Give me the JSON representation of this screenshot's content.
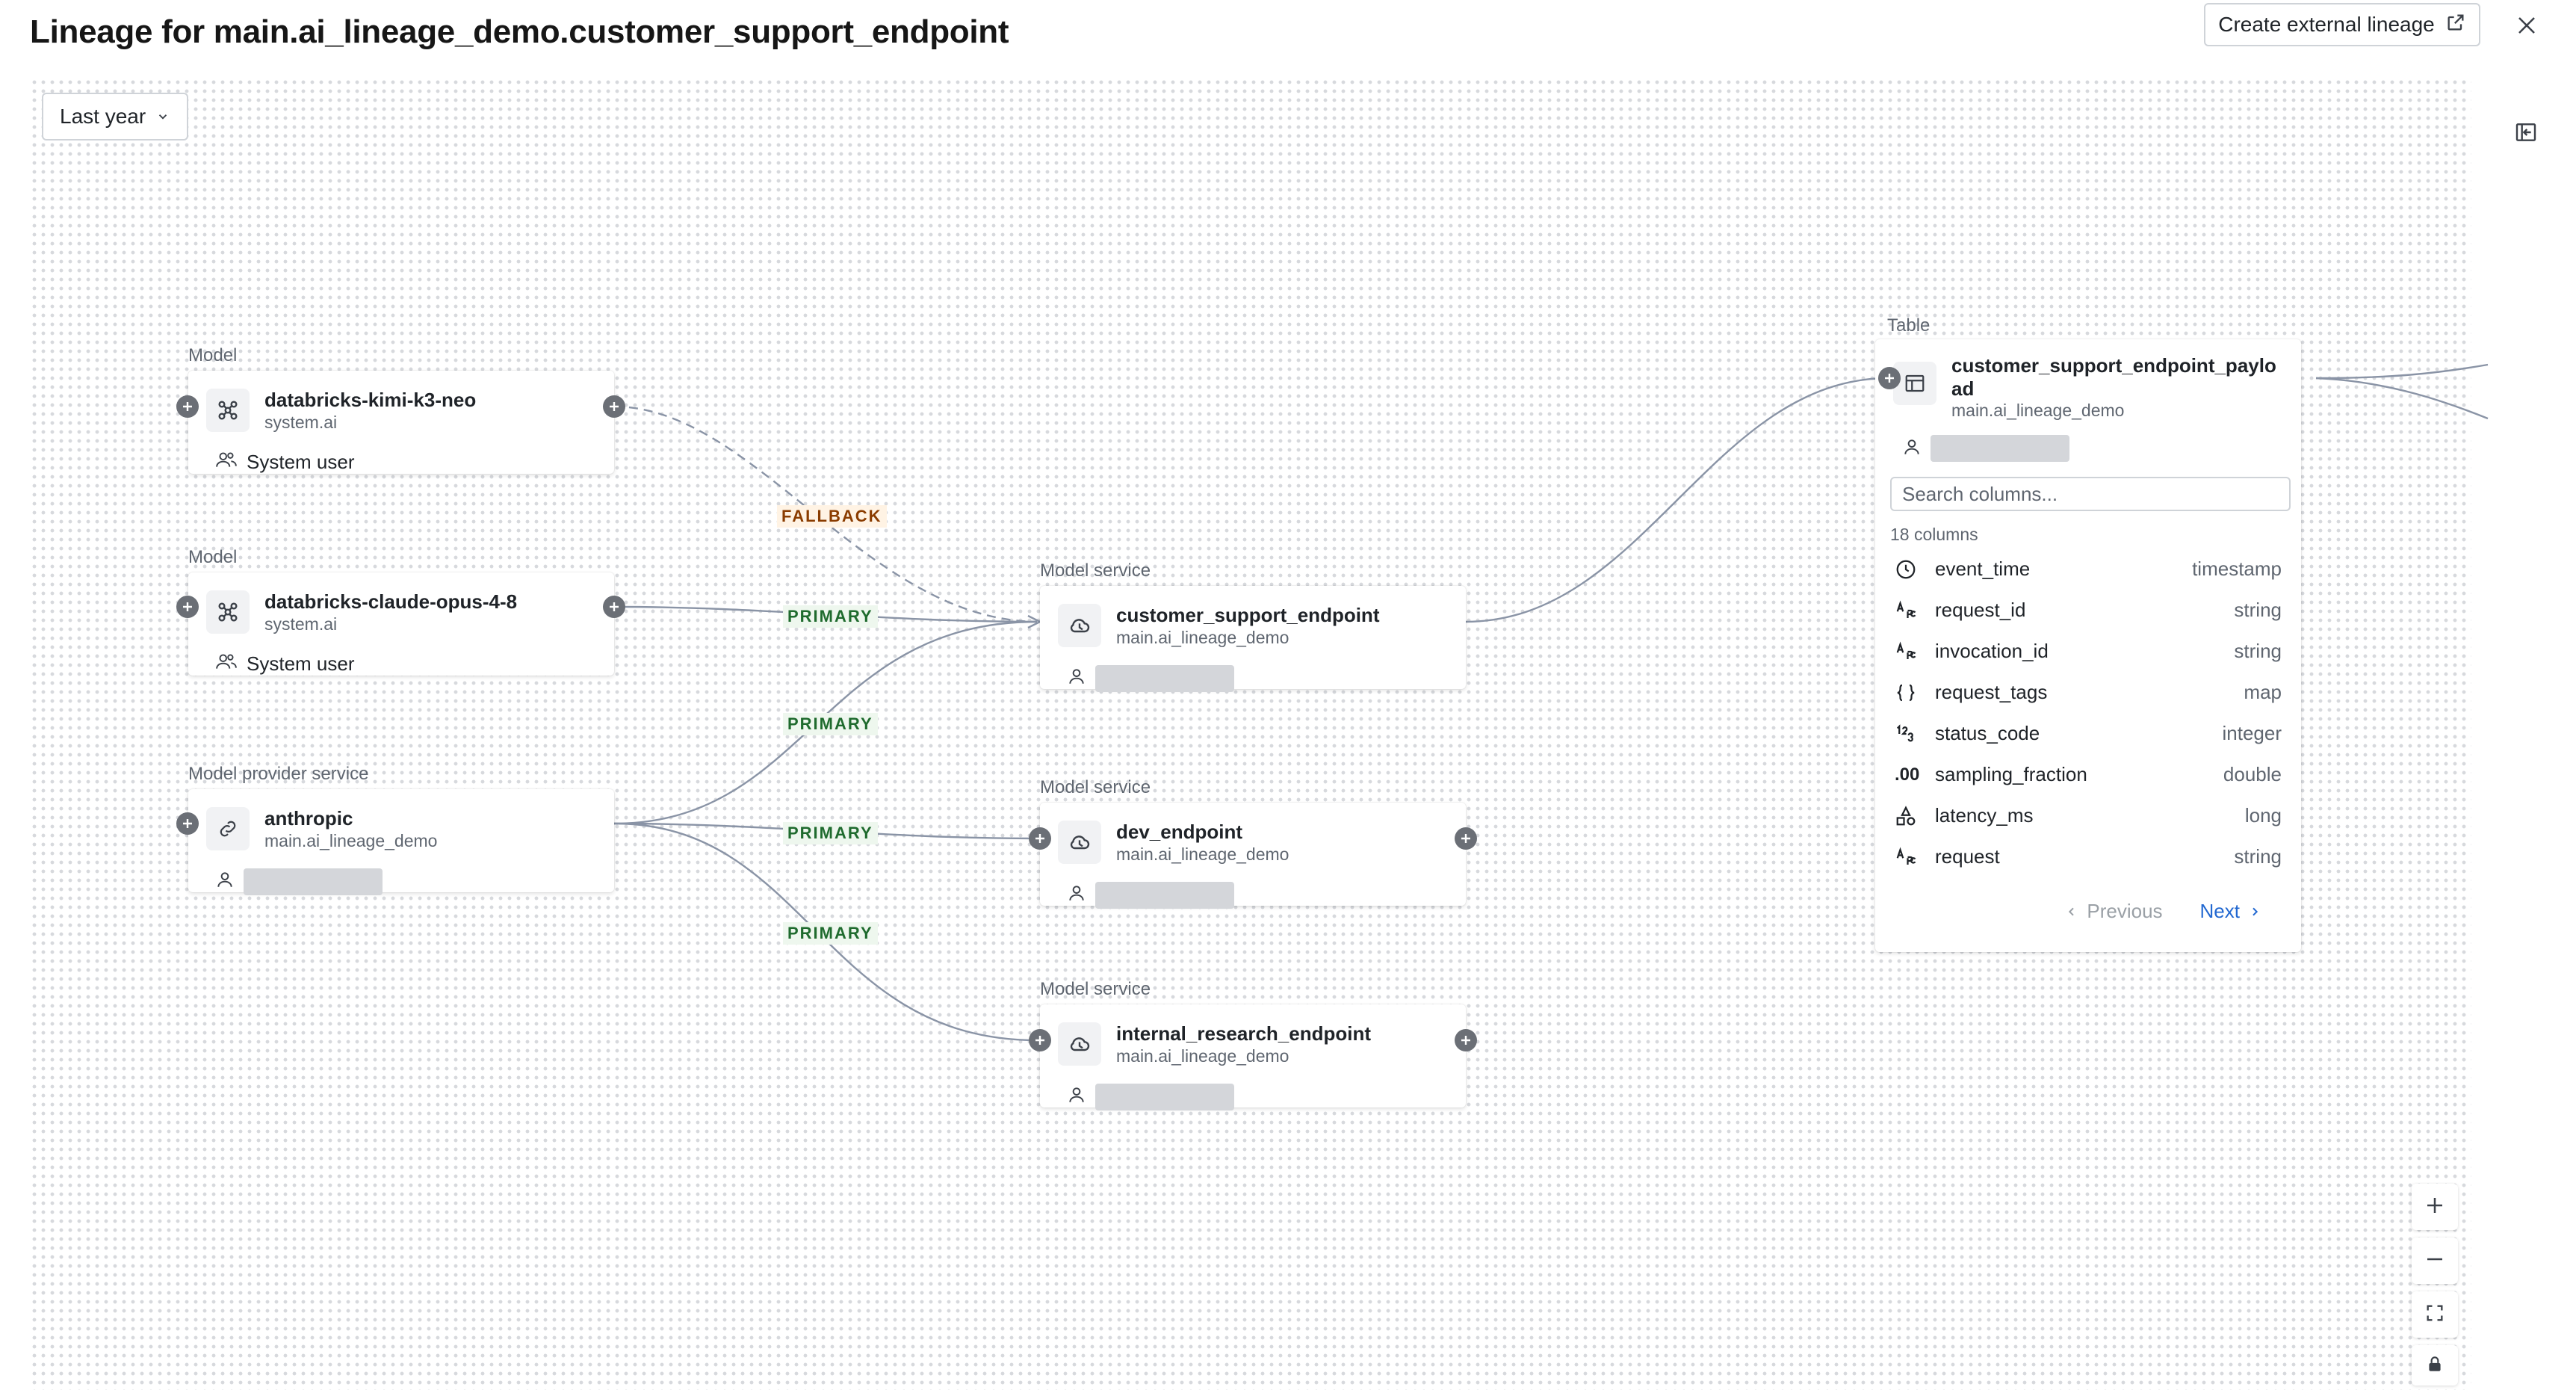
{
  "header": {
    "title": "Lineage for main.ai_lineage_demo.customer_support_endpoint",
    "create_external_lineage_label": "Create external lineage"
  },
  "filters": {
    "time_range": "Last year"
  },
  "nodes": {
    "kimi": {
      "type": "Model",
      "name": "databricks-kimi-k3-neo",
      "schema": "system.ai",
      "owner": "System user"
    },
    "claude": {
      "type": "Model",
      "name": "databricks-claude-opus-4-8",
      "schema": "system.ai",
      "owner": "System user"
    },
    "anthropic": {
      "type": "Model provider service",
      "name": "anthropic",
      "schema": "main.ai_lineage_demo"
    },
    "customer_support": {
      "type": "Model service",
      "name": "customer_support_endpoint",
      "schema": "main.ai_lineage_demo"
    },
    "dev": {
      "type": "Model service",
      "name": "dev_endpoint",
      "schema": "main.ai_lineage_demo"
    },
    "internal_research": {
      "type": "Model service",
      "name": "internal_research_endpoint",
      "schema": "main.ai_lineage_demo"
    }
  },
  "edge_labels": {
    "fallback": "FALLBACK",
    "primary_claude": "PRIMARY",
    "primary_anthropic_cs": "PRIMARY",
    "primary_anthropic_dev": "PRIMARY",
    "primary_anthropic_ir": "PRIMARY"
  },
  "table": {
    "type": "Table",
    "name": "customer_support_endpoint_payload",
    "schema": "main.ai_lineage_demo",
    "search_placeholder": "Search columns...",
    "column_count": "18 columns",
    "columns": [
      {
        "name": "event_time",
        "type": "timestamp",
        "icon": "clock-icon"
      },
      {
        "name": "request_id",
        "type": "string",
        "icon": "string-type-icon"
      },
      {
        "name": "invocation_id",
        "type": "string",
        "icon": "string-type-icon"
      },
      {
        "name": "request_tags",
        "type": "map",
        "icon": "map-type-icon"
      },
      {
        "name": "status_code",
        "type": "integer",
        "icon": "integer-type-icon"
      },
      {
        "name": "sampling_fraction",
        "type": "double",
        "icon": "double-type-icon"
      },
      {
        "name": "latency_ms",
        "type": "long",
        "icon": "long-type-icon"
      },
      {
        "name": "request",
        "type": "string",
        "icon": "string-type-icon"
      }
    ],
    "pager": {
      "previous": "Previous",
      "next": "Next"
    }
  },
  "colors": {
    "edge": "#8a94a6",
    "primary_text": "#1f6b2e",
    "fallback_text": "#8a3c00",
    "link": "#2268d1"
  }
}
